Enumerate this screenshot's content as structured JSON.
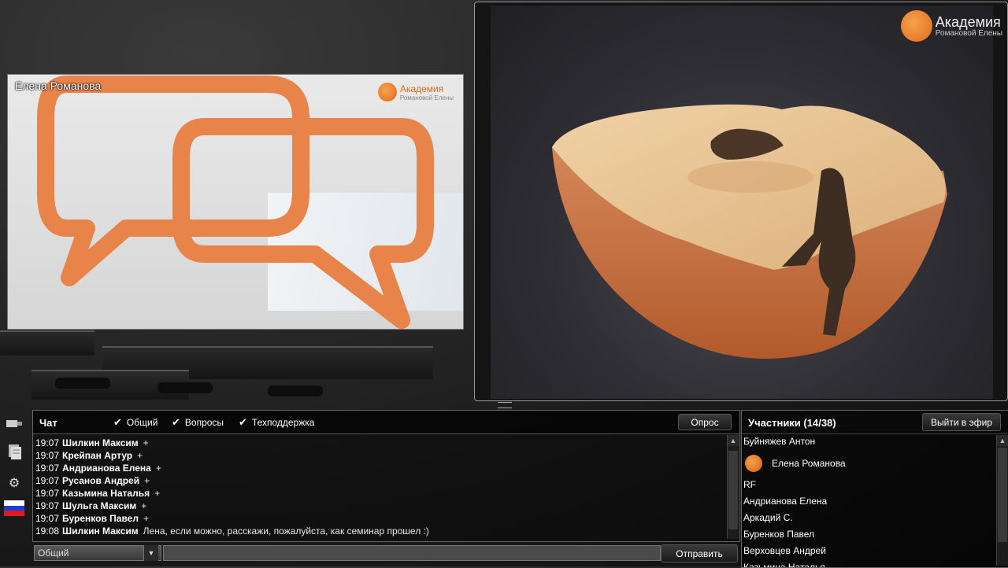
{
  "presenter": {
    "name": "Елена Романова",
    "logo_title": "Академия",
    "logo_subtitle": "Романовой Елены"
  },
  "slide": {
    "logo_title": "Академия",
    "logo_subtitle": "Романовой Елены"
  },
  "chat": {
    "title": "Чат",
    "filters": [
      {
        "label": "Общий",
        "checked": true
      },
      {
        "label": "Вопросы",
        "checked": true
      },
      {
        "label": "Техподдержка",
        "checked": true
      }
    ],
    "poll_button": "Опрос",
    "messages": [
      {
        "time": "19:07",
        "user": "Шилкин Максим",
        "text": "+"
      },
      {
        "time": "19:07",
        "user": "Крейпан Артур",
        "text": "+"
      },
      {
        "time": "19:07",
        "user": "Андрианова Елена",
        "text": "+"
      },
      {
        "time": "19:07",
        "user": "Русанов Андрей",
        "text": "+"
      },
      {
        "time": "19:07",
        "user": "Казьмина Наталья",
        "text": "+"
      },
      {
        "time": "19:07",
        "user": "Шульга Максим",
        "text": "+"
      },
      {
        "time": "19:07",
        "user": "Буренков Павел",
        "text": "+"
      },
      {
        "time": "19:08",
        "user": "Шилкин Максим",
        "text": "Лена, если можно, расскажи, пожалуйста, как семинар прошел :)"
      }
    ],
    "channel_select": "Общий",
    "message_input_value": "",
    "send_button": "Отправить"
  },
  "participants": {
    "title": "Участники (14/38)",
    "go_live_button": "Выйти в эфир",
    "items": [
      "Буйняжев Антон",
      "Елена Романова",
      "RF",
      "Андрианова Елена",
      "Аркадий С.",
      "Буренков Павел",
      "Верховцев Андрей",
      "Казьмина Наталья"
    ]
  },
  "colors": {
    "accent": "#e8834a",
    "brand_orange": "#e06a1c"
  }
}
